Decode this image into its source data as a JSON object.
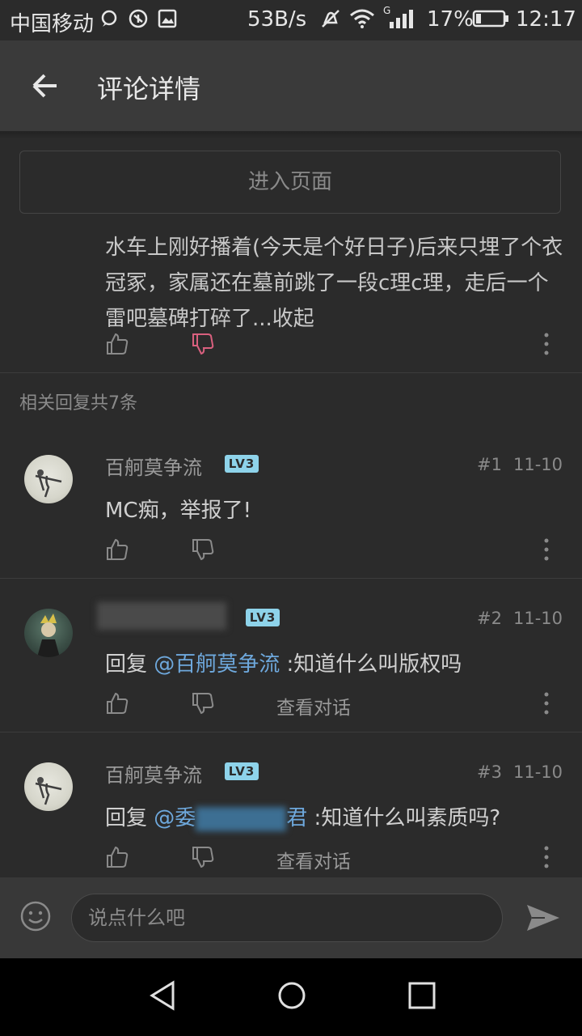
{
  "status_bar": {
    "carrier": "中国移动",
    "speed": "53B/s",
    "signal_label": "G",
    "battery": "17%",
    "time": "12:17"
  },
  "app_bar": {
    "title": "评论详情"
  },
  "enter_page": {
    "label": "进入页面"
  },
  "main_comment": {
    "text": "水车上刚好播着(今天是个好日子)后来只埋了个衣冠冢，家属还在墓前跳了一段c理c理，走后一个雷吧墓碑打碎了...收起"
  },
  "replies_header": "相关回复共7条",
  "replies": [
    {
      "username": "百舸莫争流",
      "level": "LV3",
      "floor": "#1",
      "date": "11-10",
      "text": "MC痴，举报了!"
    },
    {
      "username": "",
      "level": "LV3",
      "floor": "#2",
      "date": "11-10",
      "prefix": "回复 ",
      "mention": "@百舸莫争流",
      "text": " :知道什么叫版权吗",
      "view_conversation": "查看对话"
    },
    {
      "username": "百舸莫争流",
      "level": "LV3",
      "floor": "#3",
      "date": "11-10",
      "prefix": "回复 ",
      "mention": "@委",
      "mention_end": "君",
      "text": " :知道什么叫素质吗?",
      "view_conversation": "查看对话"
    }
  ],
  "input": {
    "placeholder": "说点什么吧"
  },
  "colors": {
    "accent_blue": "#6ea8dc",
    "dislike_pink": "#d9607e",
    "level_badge": "#8ed3ea"
  }
}
